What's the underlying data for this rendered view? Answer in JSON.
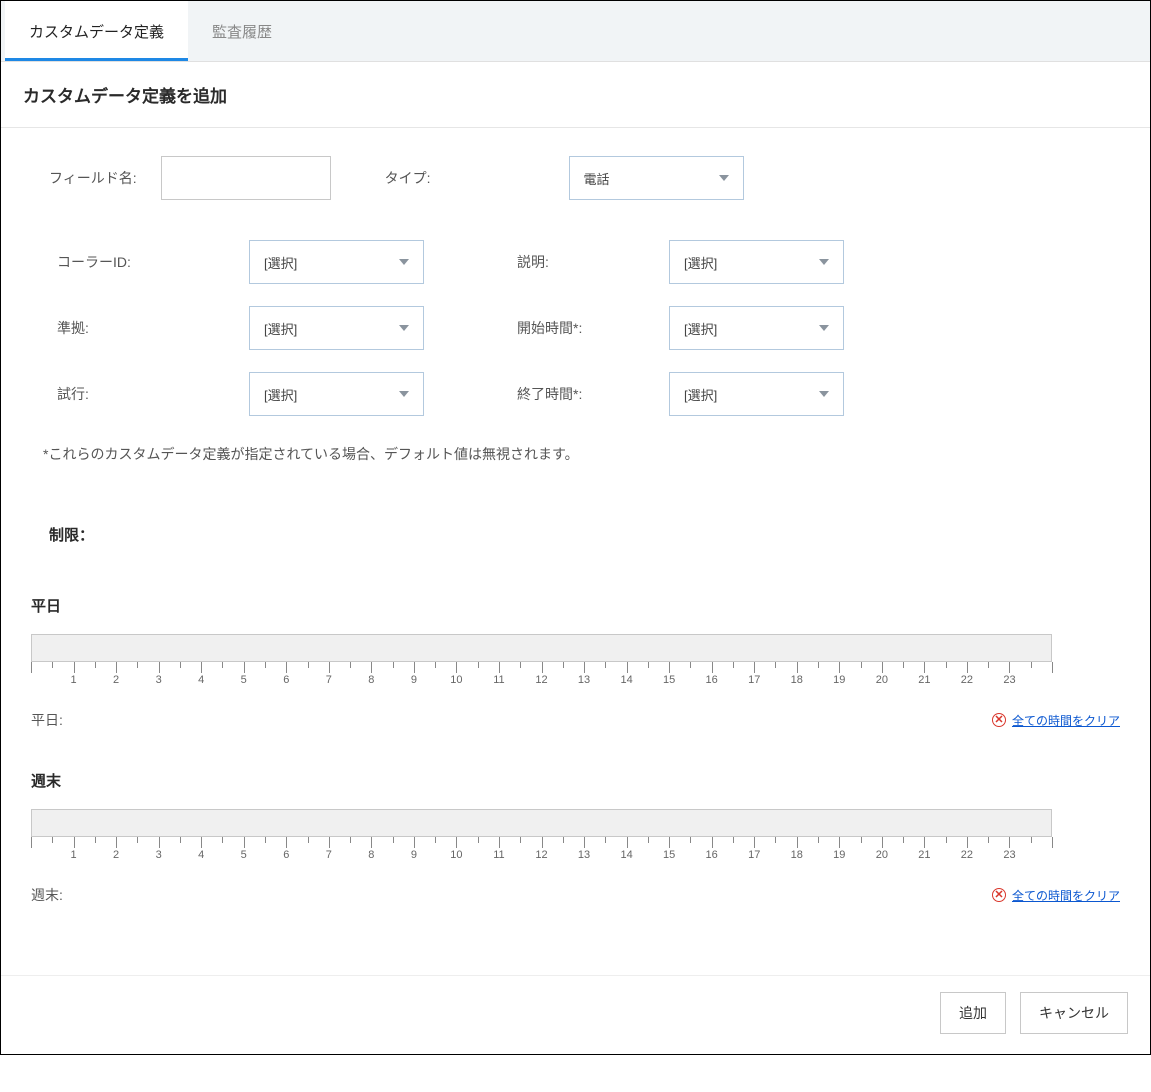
{
  "tabs": {
    "custom_data": "カスタムデータ定義",
    "audit_history": "監査履歴"
  },
  "page_title": "カスタムデータ定義を追加",
  "top_form": {
    "field_name_label": "フィールド名:",
    "field_name_value": "",
    "type_label": "タイプ:",
    "type_value": "電話"
  },
  "select_placeholder": "[選択]",
  "fields": {
    "caller_id_label": "コーラーID:",
    "description_label": "説明:",
    "compliance_label": "準拠:",
    "start_time_label": "開始時間*:",
    "attempt_label": "試行:",
    "end_time_label": "終了時間*:"
  },
  "note_text": "*これらのカスタムデータ定義が指定されている場合、デフォルト値は無視されます。",
  "restrictions_label": "制限：",
  "weekday": {
    "heading": "平日",
    "footer_label": "平日:",
    "clear_link": "全ての時間をクリア"
  },
  "weekend": {
    "heading": "週末",
    "footer_label": "週末:",
    "clear_link": "全ての時間をクリア"
  },
  "buttons": {
    "add": "追加",
    "cancel": "キャンセル"
  },
  "ruler_hours": [
    "1",
    "2",
    "3",
    "4",
    "5",
    "6",
    "7",
    "8",
    "9",
    "10",
    "11",
    "12",
    "13",
    "14",
    "15",
    "16",
    "17",
    "18",
    "19",
    "20",
    "21",
    "22",
    "23"
  ]
}
